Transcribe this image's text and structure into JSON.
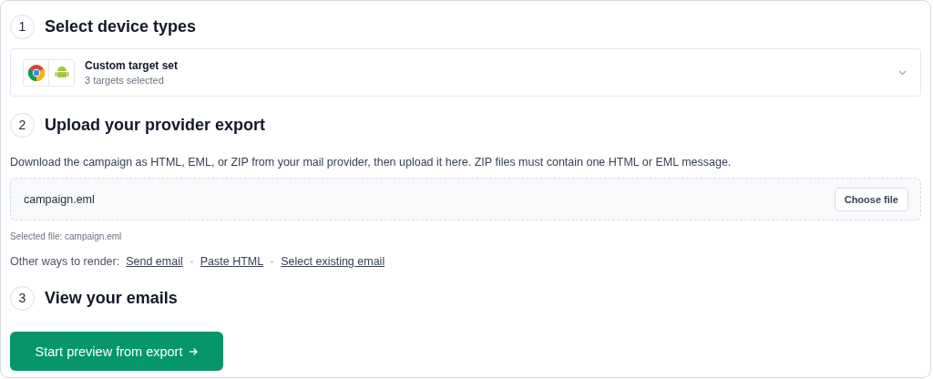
{
  "step_1": {
    "number": "1",
    "title": "Select device types",
    "device_picker": {
      "title": "Custom target set",
      "subtitle": "3 targets selected"
    }
  },
  "step_2": {
    "number": "2",
    "title": "Upload your provider export",
    "description": "Download the campaign as HTML, EML, or ZIP from your mail provider, then upload it here. ZIP files must contain one HTML or EML message.",
    "upload": {
      "file_name": "campaign.eml",
      "button": "Choose file"
    },
    "selected_file": "Selected file: campaign.eml",
    "alternatives": {
      "label": "Other ways to render:",
      "links": [
        "Send email",
        "Paste HTML",
        "Select existing email"
      ]
    }
  },
  "step_3": {
    "number": "3",
    "title": "View your emails",
    "button": "Start preview from export"
  }
}
